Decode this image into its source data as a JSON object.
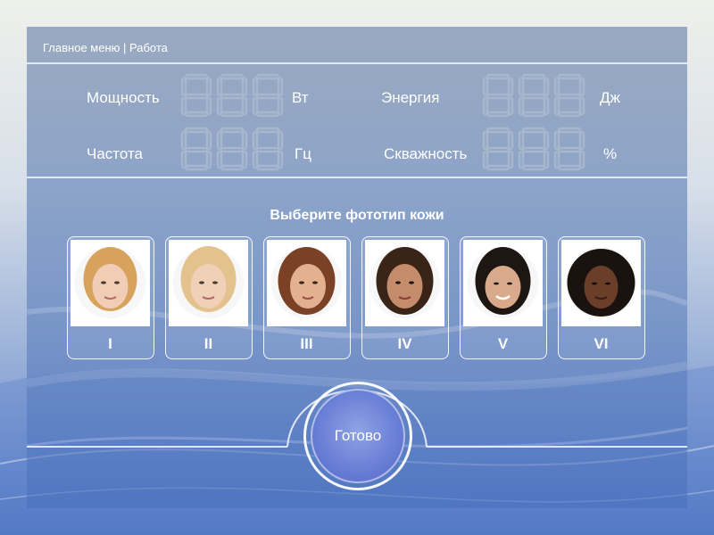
{
  "breadcrumb": "Главное меню | Работа",
  "metrics": [
    {
      "label": "Мощность",
      "unit": "Вт",
      "display": "888"
    },
    {
      "label": "Энергия",
      "unit": "Дж",
      "display": "888"
    },
    {
      "label": "Частота",
      "unit": "Гц",
      "display": "888"
    },
    {
      "label": "Скважность",
      "unit": "%",
      "display": "888"
    }
  ],
  "section_title": "Выберите фототип кожи",
  "phototypes": [
    {
      "label": "I",
      "skin": "#f1cdb6",
      "hair": "#d7a35c"
    },
    {
      "label": "II",
      "skin": "#f0d0b6",
      "hair": "#e3c28e"
    },
    {
      "label": "III",
      "skin": "#e3b18f",
      "hair": "#7a4127"
    },
    {
      "label": "IV",
      "skin": "#c48c6a",
      "hair": "#3a2418"
    },
    {
      "label": "V",
      "skin": "#d8a98a",
      "hair": "#1e1612"
    },
    {
      "label": "VI",
      "skin": "#6b3e2a",
      "hair": "#1a120e"
    }
  ],
  "done_button": "Готово",
  "colors": {
    "accent": "#6a7fd6",
    "segment_off": "#9fb1c8"
  }
}
